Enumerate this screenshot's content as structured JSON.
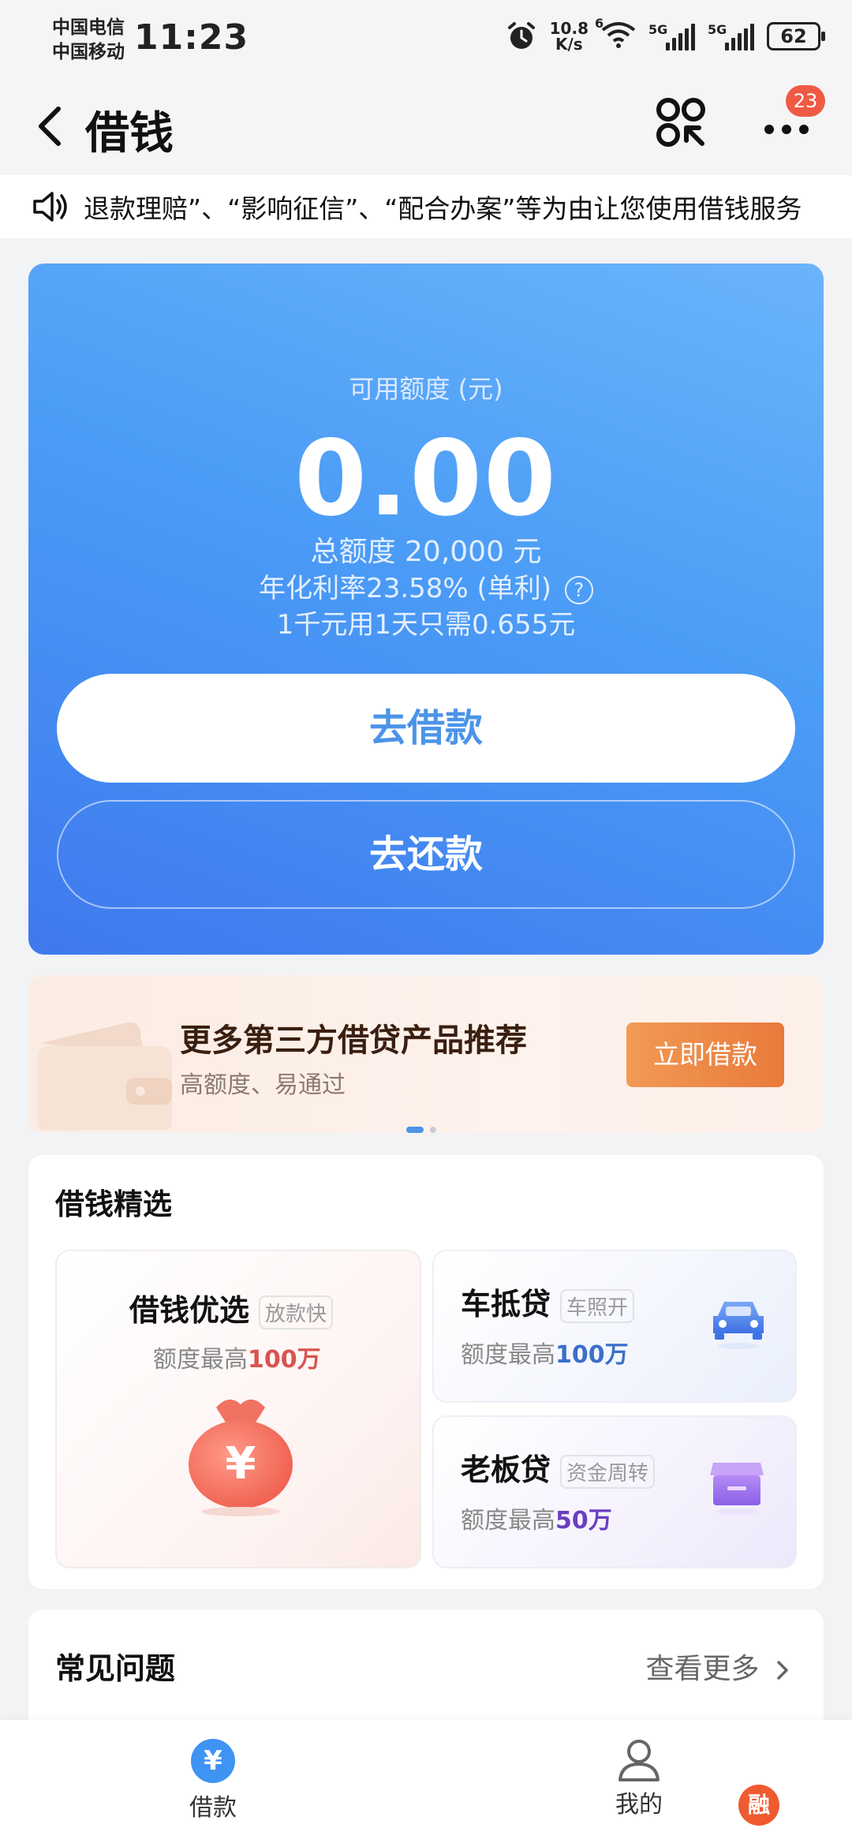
{
  "status_bar": {
    "carrier_1": "中国电信",
    "carrier_2": "中国移动",
    "time": "11:23",
    "net_speed_value": "10.8",
    "net_speed_unit": "K/s",
    "wifi_label": "6",
    "signal_1_label": "5G",
    "signal_2_label": "5G",
    "battery": "62"
  },
  "header": {
    "title": "借钱",
    "notification_count": "23"
  },
  "notice": {
    "text": "退款理赔”、“影响征信”、“配合办案”等为由让您使用借钱服务"
  },
  "credit": {
    "available_label": "可用额度 (元)",
    "available_amount": "0.00",
    "total_limit": "总额度 20,000 元",
    "annual_rate": "年化利率23.58% (单利)",
    "help_symbol": "?",
    "daily_cost": "1千元用1天只需0.655元",
    "borrow_button": "去借款",
    "repay_button": "去还款"
  },
  "promo": {
    "title": "更多第三方借贷产品推荐",
    "subtitle": "高额度、易通过",
    "button": "立即借款",
    "active_page": 1,
    "page_count": 2
  },
  "picks": {
    "title": "借钱精选",
    "main": {
      "name": "借钱优选",
      "tag": "放款快",
      "limit_prefix": "额度最高",
      "limit_value": "100万",
      "accent": "#d9534f"
    },
    "car": {
      "name": "车抵贷",
      "tag": "车照开",
      "limit_prefix": "额度最高",
      "limit_value": "100万",
      "accent": "#3b6fc9"
    },
    "boss": {
      "name": "老板贷",
      "tag": "资金周转",
      "limit_prefix": "额度最高",
      "limit_value": "50万",
      "accent": "#6a3fc0"
    }
  },
  "faq": {
    "title": "常见问题",
    "more": "查看更多"
  },
  "bottom_nav": {
    "borrow_icon": "¥",
    "borrow_label": "借款",
    "mine_label": "我的",
    "float_badge": "融"
  },
  "colors": {
    "primary_blue": "#4b94e8",
    "promo_orange": "#e97a3b",
    "badge_red": "#ef5a45"
  }
}
